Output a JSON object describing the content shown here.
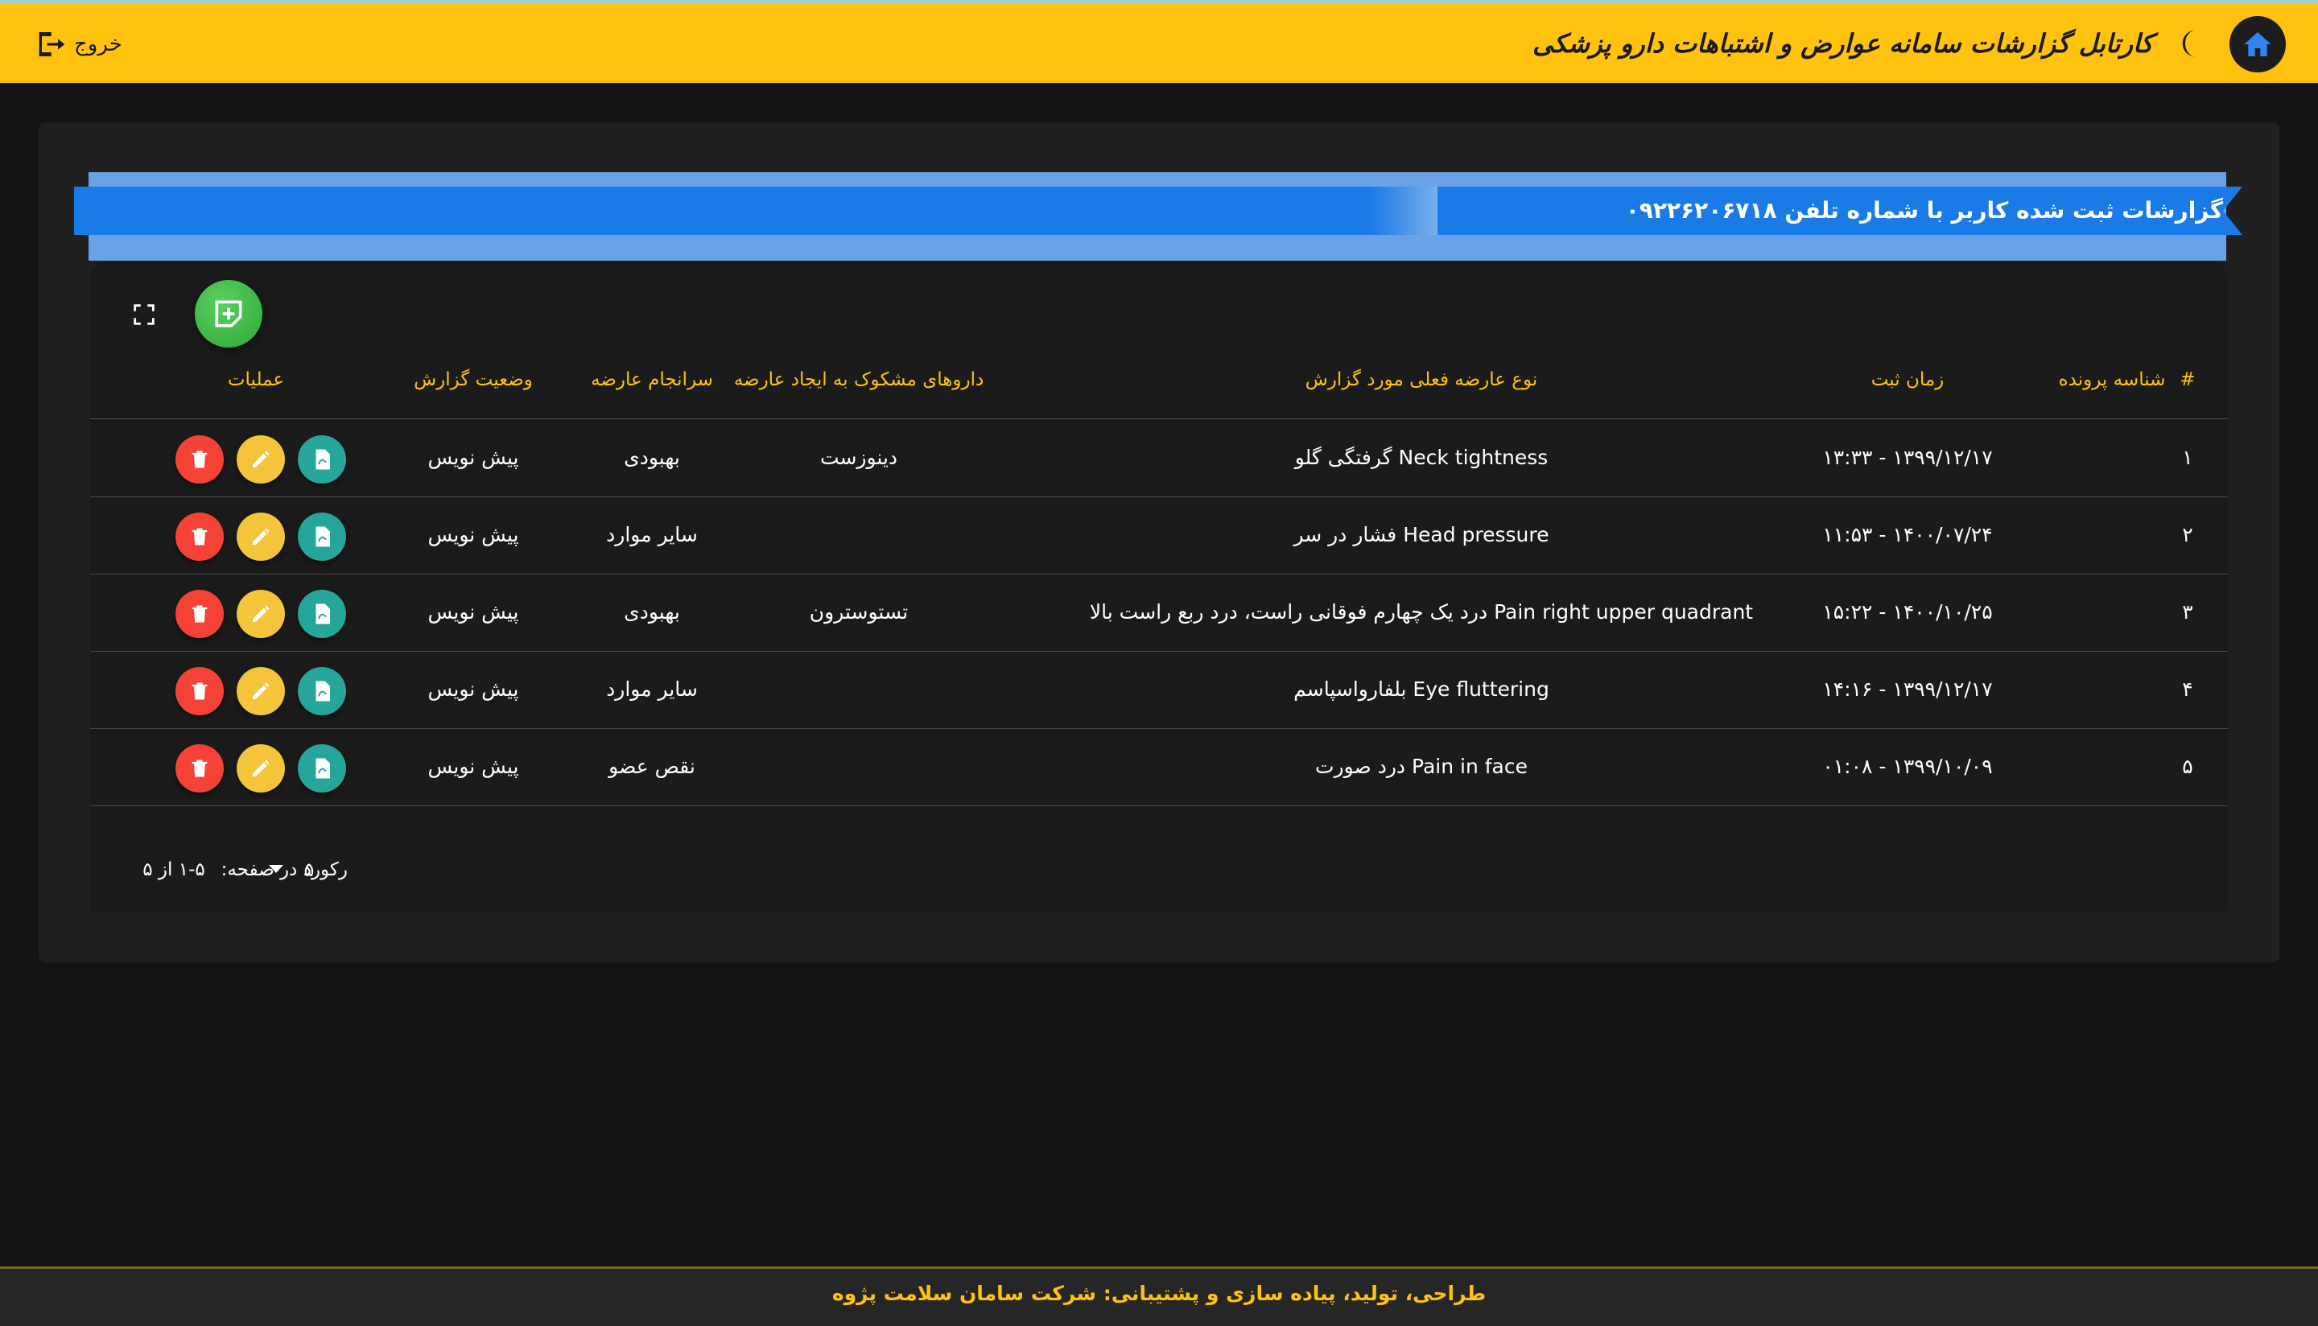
{
  "header": {
    "title": "کارتابل گزارشات سامانه عوارض و اشتباهات دارو پزشکی",
    "logout_label": "خروج",
    "home_icon": "home-icon",
    "theme_icon": "moon-icon"
  },
  "panel": {
    "heading": "گزارشات ثبت شده کاربر با شماره تلفن ۰۹۲۲۶۲۰۶۷۱۸"
  },
  "table": {
    "columns": {
      "index": "#",
      "file_id": "شناسه پرونده",
      "time": "زمان ثبت",
      "reaction": "نوع عارضه فعلی مورد گزارش",
      "drugs": "داروهای مشکوک به ایجاد عارضه",
      "outcome": "سرانجام عارضه",
      "status": "وضعیت گزارش",
      "actions": "عملیات"
    },
    "rows": [
      {
        "index": "۱",
        "file_id": "",
        "time": "۱۳۹۹/۱۲/۱۷ - ۱۳:۳۳",
        "reaction": "Neck tightness گرفتگی گلو",
        "drugs": "دینوزست",
        "outcome": "بهبودی",
        "status": "پیش نویس"
      },
      {
        "index": "۲",
        "file_id": "",
        "time": "۱۴۰۰/۰۷/۲۴ - ۱۱:۵۳",
        "reaction": "Head pressure فشار در سر",
        "drugs": "",
        "outcome": "سایر موارد",
        "status": "پیش نویس"
      },
      {
        "index": "۳",
        "file_id": "",
        "time": "۱۴۰۰/۱۰/۲۵ - ۱۵:۲۲",
        "reaction": "Pain right upper quadrant درد یک چهارم فوقانی راست، درد ربع راست بالا",
        "drugs": "تستوسترون",
        "outcome": "بهبودی",
        "status": "پیش نویس"
      },
      {
        "index": "۴",
        "file_id": "",
        "time": "۱۳۹۹/۱۲/۱۷ - ۱۴:۱۶",
        "reaction": "Eye fluttering بلفارواسپاسم",
        "drugs": "",
        "outcome": "سایر موارد",
        "status": "پیش نویس"
      },
      {
        "index": "۵",
        "file_id": "",
        "time": "۱۳۹۹/۱۰/۰۹ - ۰۱:۰۸",
        "reaction": "Pain in face درد صورت",
        "drugs": "",
        "outcome": "نقص عضو",
        "status": "پیش نویس"
      }
    ]
  },
  "pagination": {
    "rows_per_page_label": "رکورد در صفحه:",
    "rows_per_page_value": "۵",
    "range": "۱-۵ از ۵"
  },
  "footer": {
    "credit": "طراحی، تولید، پیاده سازی و پشتیبانی: شرکت سامان سلامت پژوه"
  },
  "colors": {
    "accent": "#ffc20e",
    "ribbon": "#1b7be6",
    "add": "#2ea83a",
    "pdf": "#26a69a",
    "edit": "#f4c43a",
    "delete": "#f44336"
  }
}
